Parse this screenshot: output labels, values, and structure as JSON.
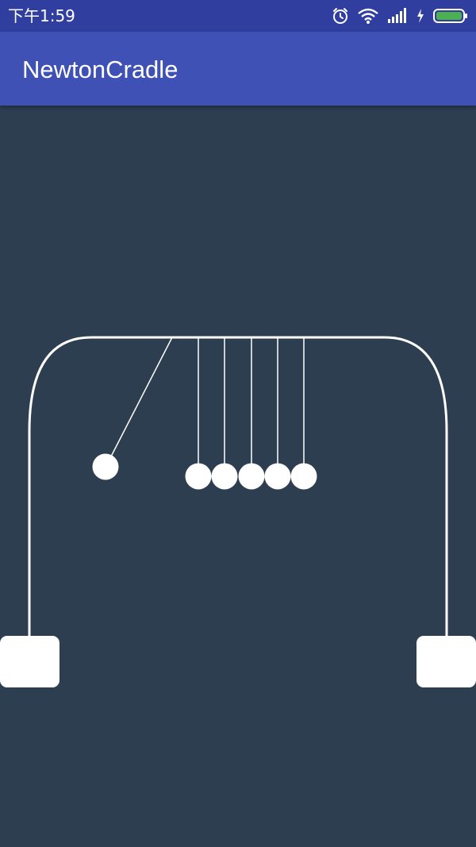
{
  "status_bar": {
    "time": "下午1:59",
    "icons": [
      "alarm-icon",
      "wifi-icon",
      "signal-icon",
      "charging-icon",
      "battery-icon"
    ],
    "battery_color": "#4caf50"
  },
  "app_bar": {
    "title": "NewtonCradle",
    "color": "#3f51b5"
  },
  "cradle": {
    "background_color": "#2c3e50",
    "ball_color": "#ffffff",
    "ball_count": 6
  }
}
